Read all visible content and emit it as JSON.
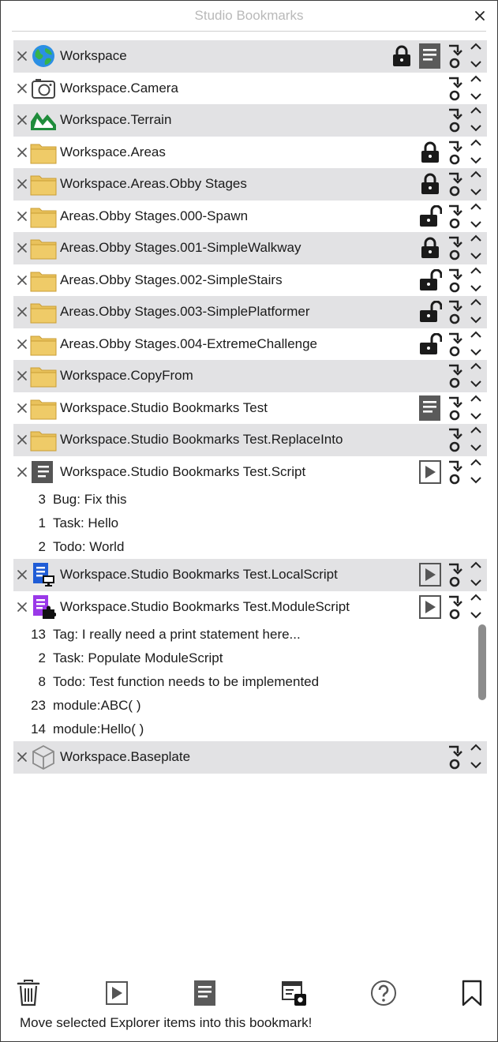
{
  "window": {
    "title": "Studio Bookmarks"
  },
  "rows": [
    {
      "label": "Workspace",
      "icon": "globe-icon",
      "alt": true,
      "lock": "locked",
      "script": "script-icon",
      "script_filled": true,
      "subs": []
    },
    {
      "label": "Workspace.Camera",
      "icon": "camera-icon",
      "alt": false,
      "lock": "",
      "script": "",
      "subs": []
    },
    {
      "label": "Workspace.Terrain",
      "icon": "terrain-icon",
      "alt": true,
      "lock": "",
      "script": "",
      "subs": []
    },
    {
      "label": "Workspace.Areas",
      "icon": "folder-icon",
      "alt": false,
      "lock": "locked",
      "script": "",
      "subs": []
    },
    {
      "label": "Workspace.Areas.Obby Stages",
      "icon": "folder-icon",
      "alt": true,
      "lock": "locked",
      "script": "",
      "subs": []
    },
    {
      "label": "Areas.Obby Stages.000-Spawn",
      "icon": "folder-icon",
      "alt": false,
      "lock": "unlocked",
      "script": "",
      "subs": []
    },
    {
      "label": "Areas.Obby Stages.001-SimpleWalkway",
      "icon": "folder-icon",
      "alt": true,
      "lock": "locked",
      "script": "",
      "subs": []
    },
    {
      "label": "Areas.Obby Stages.002-SimpleStairs",
      "icon": "folder-icon",
      "alt": false,
      "lock": "unlocked",
      "script": "",
      "subs": []
    },
    {
      "label": "Areas.Obby Stages.003-SimplePlatformer",
      "icon": "folder-icon",
      "alt": true,
      "lock": "unlocked",
      "script": "",
      "subs": []
    },
    {
      "label": "Areas.Obby Stages.004-ExtremeChallenge",
      "icon": "folder-icon",
      "alt": false,
      "lock": "unlocked",
      "script": "",
      "subs": []
    },
    {
      "label": "Workspace.CopyFrom",
      "icon": "folder-icon",
      "alt": true,
      "lock": "",
      "script": "",
      "subs": []
    },
    {
      "label": "Workspace.Studio Bookmarks Test",
      "icon": "folder-icon",
      "alt": false,
      "lock": "",
      "script": "script-icon",
      "subs": []
    },
    {
      "label": "Workspace.Studio Bookmarks Test.ReplaceInto",
      "icon": "folder-icon",
      "alt": true,
      "lock": "",
      "script": "",
      "subs": []
    },
    {
      "label": "Workspace.Studio Bookmarks Test.Script",
      "icon": "script-icon",
      "alt": false,
      "lock": "",
      "script": "play-script-icon",
      "subs": [
        {
          "num": "3",
          "text": "Bug: Fix this"
        },
        {
          "num": "1",
          "text": "Task: Hello"
        },
        {
          "num": "2",
          "text": "Todo: World"
        }
      ]
    },
    {
      "label": "Workspace.Studio Bookmarks Test.LocalScript",
      "icon": "local-script-icon",
      "alt": true,
      "lock": "",
      "script": "play-script-icon",
      "subs": []
    },
    {
      "label": "Workspace.Studio Bookmarks Test.ModuleScript",
      "icon": "module-script-icon",
      "alt": false,
      "lock": "",
      "script": "play-script-icon",
      "subs": [
        {
          "num": "13",
          "text": "Tag: I really need a print statement here..."
        },
        {
          "num": "2",
          "text": "Task: Populate ModuleScript"
        },
        {
          "num": "8",
          "text": "Todo: Test function needs to be implemented"
        },
        {
          "num": "23",
          "text": "module:ABC(  )"
        },
        {
          "num": "14",
          "text": "module:Hello(  )"
        }
      ]
    },
    {
      "label": "Workspace.Baseplate",
      "icon": "part-icon",
      "alt": true,
      "lock": "",
      "script": "",
      "subs": []
    }
  ],
  "toolbar": {
    "buttons": [
      "trash-icon",
      "play-script-icon",
      "script-icon",
      "select-window-icon",
      "help-icon",
      "bookmark-icon"
    ]
  },
  "status": {
    "text": "Move selected Explorer items into this bookmark!"
  },
  "colors": {
    "folder": "#e9c25c",
    "terrain": "#1f8c3b",
    "local_script": "#1f5cd6",
    "module_script": "#9a38e8"
  }
}
